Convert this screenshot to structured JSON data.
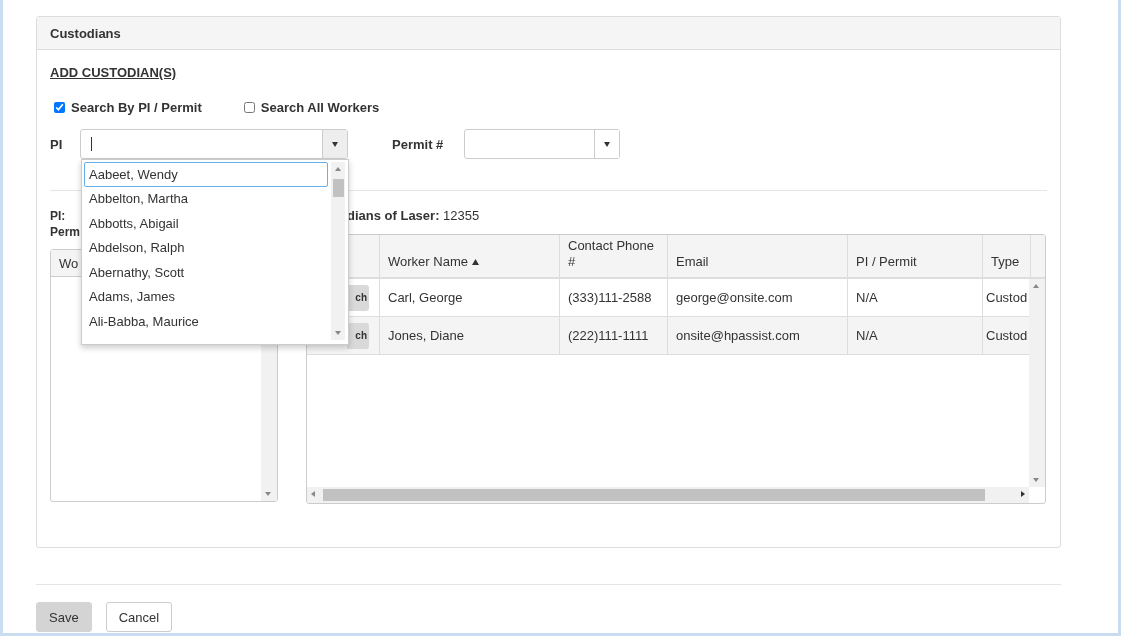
{
  "panel": {
    "title": "Custodians",
    "add_link": "ADD CUSTODIAN(S)",
    "search_options": [
      {
        "label": "Search By PI / Permit",
        "checked": true
      },
      {
        "label": "Search All Workers",
        "checked": false
      }
    ],
    "pi_field": {
      "label": "PI",
      "options": [
        {
          "label": "Aabeet, Wendy",
          "selected": true
        },
        {
          "label": "Abbelton, Martha",
          "selected": false
        },
        {
          "label": "Abbotts, Abigail",
          "selected": false
        },
        {
          "label": "Abdelson, Ralph",
          "selected": false
        },
        {
          "label": "Abernathy, Scott",
          "selected": false
        },
        {
          "label": "Adams, James",
          "selected": false
        },
        {
          "label": "Ali-Babba, Maurice",
          "selected": false
        }
      ]
    },
    "permit_field": {
      "label": "Permit #"
    },
    "left": {
      "labels": [
        "PI:",
        "Perm"
      ],
      "grid_header": "Wo"
    },
    "right": {
      "heading": "**dians of Laser:** 12355",
      "columns": [
        {
          "label": "Worker Name",
          "sorted": true
        },
        {
          "label": "Contact Phone #",
          "sorted": false
        },
        {
          "label": "Email",
          "sorted": false
        },
        {
          "label": "PI / Permit",
          "sorted": false
        },
        {
          "label": "Type",
          "sorted": false
        }
      ],
      "rows": [
        {
          "action": "ch",
          "cells": [
            "Carl, George",
            "(333)111-2588",
            "george@onsite.com",
            "N/A",
            "Custod"
          ]
        },
        {
          "action": "ch",
          "cells": [
            "Jones, Diane",
            "(222)111-1111",
            "onsite@hpassist.com",
            "N/A",
            "Custod"
          ]
        }
      ]
    }
  },
  "buttons": [
    {
      "label": "Save",
      "kind": "shaded"
    },
    {
      "label": "Cancel",
      "kind": "plain"
    }
  ]
}
